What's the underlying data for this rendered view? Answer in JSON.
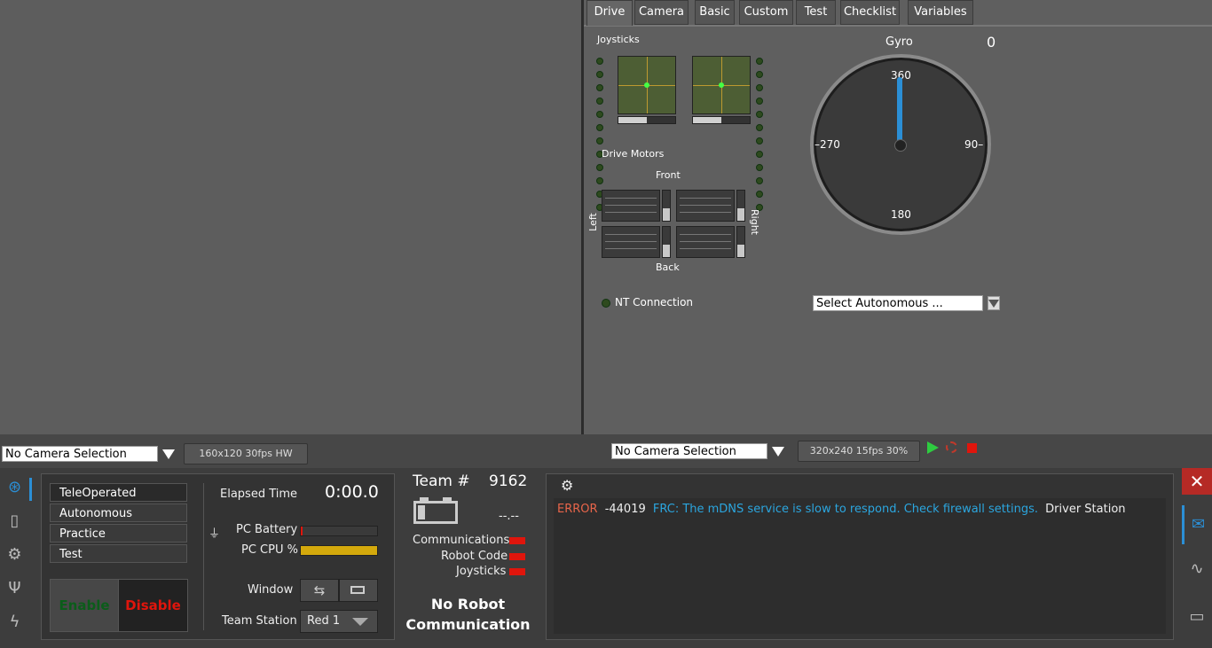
{
  "dashboard": {
    "tabs": [
      "Drive",
      "Camera",
      "Basic",
      "Custom",
      "Test",
      "Checklist",
      "Variables"
    ],
    "joysticks_label": "Joysticks",
    "drive_motors_label": "Drive Motors",
    "front_label": "Front",
    "back_label": "Back",
    "left_label": "Left",
    "right_label": "Right",
    "nt_connection_label": "NT Connection",
    "gyro": {
      "label": "Gyro",
      "value": "0",
      "tick_360": "360",
      "tick_90": "90–",
      "tick_180": "180",
      "tick_270": "–270"
    },
    "autonomous_select": "Select Autonomous ...",
    "colors": {
      "accent": "#2b8fd6",
      "error": "#e0150c",
      "battery_bar": "#d4a90c"
    }
  },
  "camera_bar_left": {
    "selection": "No Camera Selection",
    "info": "160x120   30fps   HW"
  },
  "camera_bar_right": {
    "selection": "No Camera Selection",
    "info": "320x240   15fps   30%"
  },
  "driver_station": {
    "modes": [
      "TeleOperated",
      "Autonomous",
      "Practice",
      "Test"
    ],
    "enable_label": "Enable",
    "disable_label": "Disable",
    "elapsed_label": "Elapsed Time",
    "elapsed_value": "0:00.0",
    "pc_battery_label": "PC Battery",
    "pc_cpu_label": "PC CPU %",
    "window_label": "Window",
    "team_station_label": "Team Station",
    "team_station_value": "Red 1",
    "team_label": "Team #",
    "team_number": "9162",
    "battery_voltage": "--.--",
    "communications_label": "Communications",
    "robot_code_label": "Robot Code",
    "joysticks_label": "Joysticks",
    "status_line1": "No Robot",
    "status_line2": "Communication",
    "message": {
      "level": "ERROR",
      "code": "-44019",
      "text": "FRC: The mDNS service is slow to respond. Check firewall settings.",
      "source": "Driver Station"
    }
  }
}
